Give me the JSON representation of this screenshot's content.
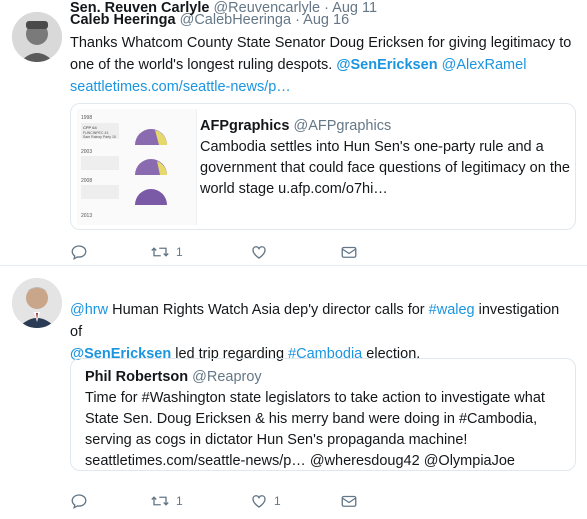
{
  "tweets": [
    {
      "name": "Caleb Heeringa",
      "handle": "@CalebHeeringa",
      "separator": "·",
      "time": "Aug 16",
      "text_1": "Thanks Whatcom County State Senator Doug Ericksen for giving legitimacy to one of the world's longest ruling despots. ",
      "mention_1": "@SenEricksen",
      "mention_2": "@AlexRamel",
      "url": "seattletimes.com/seattle-news/p…",
      "card": {
        "name": "AFPgraphics",
        "handle": "@AFPgraphics",
        "text": "Cambodia settles into Hun Sen's one-party rule and a government that could face questions of legitimacy on the world stage u.afp.com/o7hi…",
        "thumb_year_1": "1998",
        "thumb_year_2": "2003",
        "thumb_year_3": "2008",
        "thumb_year_4": "2013",
        "thumb_label_cpp": "CPP 64",
        "thumb_label_frk": "FUNCINPEC 43",
        "thumb_label_sr": "Sam Rainsy Party 15"
      },
      "actions": {
        "replies": "",
        "retweets": "1",
        "likes": ""
      }
    },
    {
      "name": "Sen. Reuven Carlyle",
      "handle": "@Reuvencarlyle",
      "separator": "·",
      "time": "Aug 11",
      "mention_hrw": "@hrw",
      "text_1": " Human Rights Watch Asia dep'y director calls for ",
      "hashtag_waleg": "#waleg",
      "text_2": " investigation of ",
      "mention_sen": "@SenEricksen",
      "text_3": " led trip regarding ",
      "hashtag_cambodia": "#Cambodia",
      "text_4": " election.",
      "quote": {
        "name": "Phil Robertson",
        "handle": "@Reaproy",
        "text": "Time for #Washington state legislators to take action to investigate what State Sen. Doug Ericksen & his merry band were doing in #Cambodia, serving as cogs in dictator Hun Sen's propaganda machine! seattletimes.com/seattle-news/p… @wheresdoug42 @OlympiaJoe"
      },
      "actions": {
        "replies": "",
        "retweets": "1",
        "likes": "1"
      }
    }
  ],
  "colors": {
    "link": "#1b95e0",
    "muted": "#657786",
    "border": "#e1e8ed",
    "text": "#14171a"
  },
  "icons": [
    "reply-icon",
    "retweet-icon",
    "like-icon",
    "dm-icon"
  ]
}
